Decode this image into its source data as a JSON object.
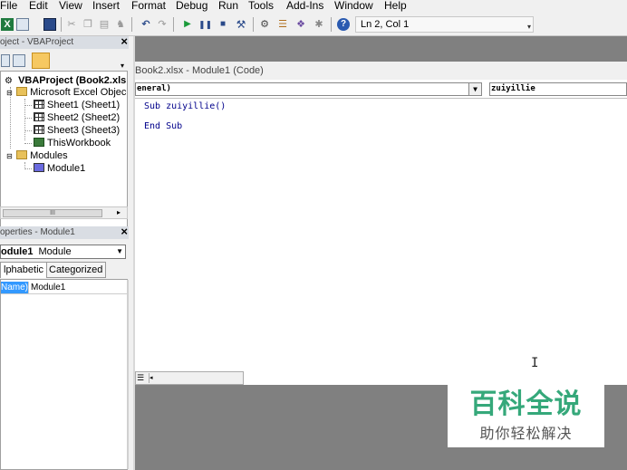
{
  "menu": {
    "items": [
      "File",
      "Edit",
      "View",
      "Insert",
      "Format",
      "Debug",
      "Run",
      "Tools",
      "Add-Ins",
      "Window",
      "Help"
    ]
  },
  "toolbar": {
    "position_label": "Ln 2, Col 1",
    "icons": [
      "excel-icon",
      "insert-module-icon",
      "save-icon",
      "cut-icon",
      "copy-icon",
      "paste-icon",
      "find-icon",
      "undo-icon",
      "redo-icon",
      "run-icon",
      "break-icon",
      "reset-icon",
      "design-mode-icon",
      "project-explorer-icon",
      "properties-window-icon",
      "object-browser-icon",
      "toolbox-icon",
      "help-icon"
    ]
  },
  "project_explorer": {
    "title": "oject - VBAProject",
    "close": "×",
    "root": "VBAProject (Book2.xls",
    "folder_objects": "Microsoft Excel Objec",
    "sheets": [
      "Sheet1 (Sheet1)",
      "Sheet2 (Sheet2)",
      "Sheet3 (Sheet3)"
    ],
    "workbook": "ThisWorkbook",
    "folder_modules": "Modules",
    "module": "Module1",
    "scroll_thumb": "III"
  },
  "properties": {
    "title": "operties - Module1",
    "close": "×",
    "object_name": "odule1",
    "object_type": "Module",
    "tabs": [
      "lphabetic",
      "Categorized"
    ],
    "row_name_label": "Name)",
    "row_name_value": "Module1"
  },
  "code_window": {
    "title": "Book2.xlsx - Module1 (Code)",
    "object_combo": "eneral)",
    "procedure_combo": "zuiyillie",
    "lines": [
      "Sub zuiyillie()",
      "End Sub"
    ]
  },
  "watermark": {
    "title": "百科全说",
    "subtitle": "助你轻松解决"
  }
}
